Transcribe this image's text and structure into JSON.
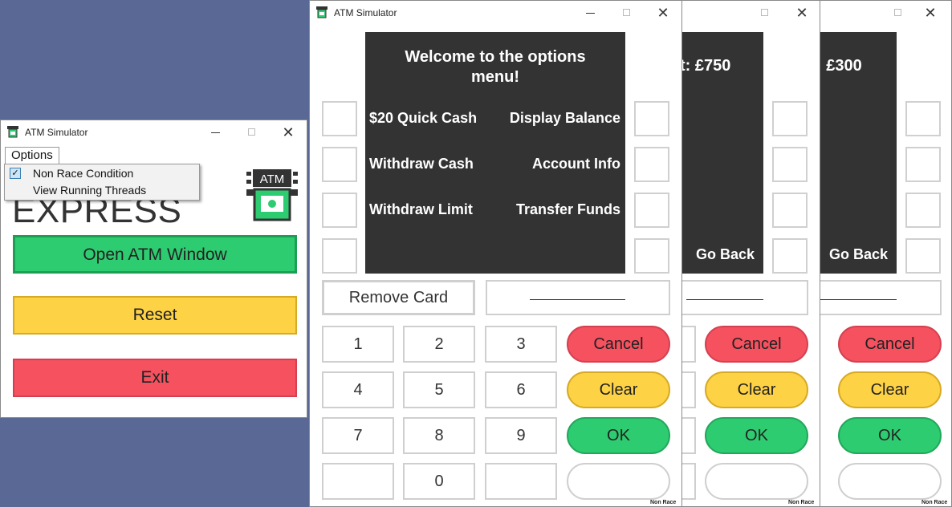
{
  "launcher": {
    "title": "ATM Simulator",
    "menu_label": "Options",
    "menu_items": [
      {
        "label": "Non Race Condition",
        "checked": true
      },
      {
        "label": "View Running Threads",
        "checked": false
      }
    ],
    "brand_text": "EXPRESS",
    "logo_text": "ATM",
    "open_button": "Open ATM Window",
    "reset_button": "Reset",
    "exit_button": "Exit"
  },
  "atm_main": {
    "title": "ATM Simulator",
    "heading": "Welcome to the options menu!",
    "options_left": [
      "$20 Quick Cash",
      "Withdraw Cash",
      "Withdraw Limit"
    ],
    "options_right": [
      "Display Balance",
      "Account Info",
      "Transfer Funds"
    ],
    "remove_card": "Remove Card",
    "entry_value": "",
    "keys": [
      "1",
      "2",
      "3",
      "4",
      "5",
      "6",
      "7",
      "8",
      "9",
      "",
      "0",
      ""
    ],
    "cancel": "Cancel",
    "clear": "Clear",
    "ok": "OK",
    "footer": "Non Race"
  },
  "atm_back1": {
    "screen_text": "t: £750",
    "go_back": "Go Back",
    "cancel": "Cancel",
    "clear": "Clear",
    "ok": "OK",
    "footer": "Non Race"
  },
  "atm_back2": {
    "screen_text": ": £300",
    "go_back": "Go Back",
    "cancel": "Cancel",
    "clear": "Clear",
    "ok": "OK",
    "footer": "Non Race"
  },
  "colors": {
    "desktop": "#5a6896",
    "green": "#2ecc71",
    "yellow": "#fed245",
    "red": "#f5515f",
    "screen": "#333333"
  }
}
